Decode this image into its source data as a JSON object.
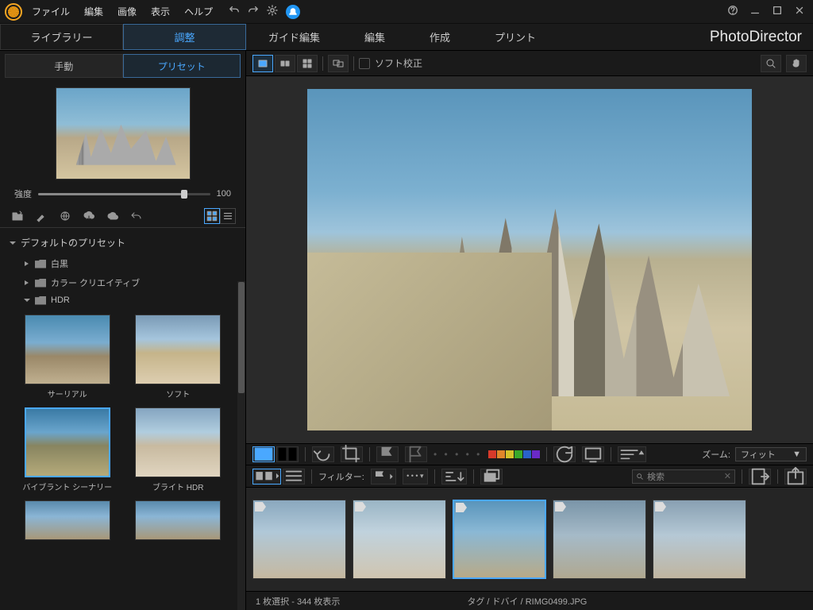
{
  "menu": {
    "file": "ファイル",
    "edit": "編集",
    "image": "画像",
    "view": "表示",
    "help": "ヘルプ"
  },
  "brand": "PhotoDirector",
  "nav": {
    "library": "ライブラリー",
    "adjust": "調整",
    "guided": "ガイド編集",
    "edit": "編集",
    "create": "作成",
    "print": "プリント"
  },
  "subtabs": {
    "manual": "手動",
    "preset": "プリセット"
  },
  "intensity": {
    "label": "強度",
    "value": "100"
  },
  "tree": {
    "header": "デフォルトのプリセット",
    "bw": "白黒",
    "color": "カラー クリエイティブ",
    "hdr": "HDR"
  },
  "presets": {
    "surreal": "サーリアル",
    "soft": "ソフト",
    "vibrant": "バイブラント シーナリー",
    "bright": "ブライト HDR"
  },
  "viewbar": {
    "softproof": "ソフト校正"
  },
  "colors": [
    "#d73a2a",
    "#e0862a",
    "#d4c22a",
    "#3aa82a",
    "#2a62c8",
    "#6a2ac8"
  ],
  "zoom": {
    "label": "ズーム:",
    "value": "フィット"
  },
  "filter": {
    "label": "フィルター:",
    "search": "検索"
  },
  "status": {
    "sel": "1 枚選択 - 344 枚表示",
    "path": "タグ / ドバイ / RIMG0499.JPG"
  }
}
